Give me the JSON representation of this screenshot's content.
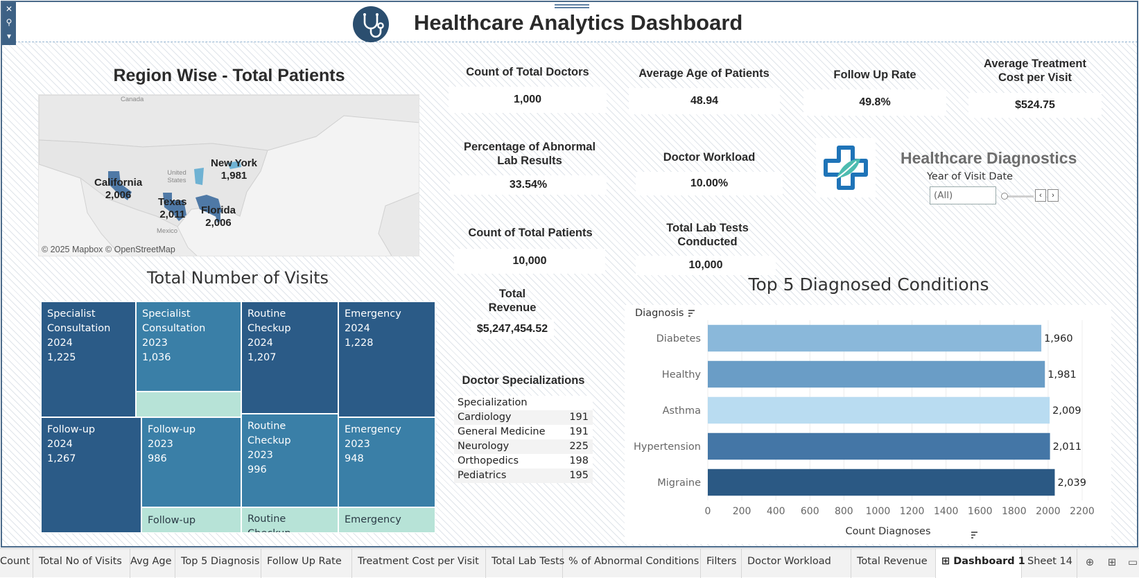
{
  "header": {
    "title": "Healthcare Analytics Dashboard"
  },
  "map": {
    "title": "Region Wise - Total Patients",
    "countries": {
      "canada": "Canada",
      "usa": "United States",
      "mexico": "Mexico"
    },
    "regions": [
      {
        "name": "California",
        "value": "2,006"
      },
      {
        "name": "New York",
        "value": "1,981"
      },
      {
        "name": "Texas",
        "value": "2,011"
      },
      {
        "name": "Florida",
        "value": "2,006"
      }
    ],
    "credit": "© 2025 Mapbox © OpenStreetMap",
    "fill_color": "#4f79a6",
    "ny_color": "#6fb2d3"
  },
  "kpis": {
    "doctors": {
      "label": "Count of Total Doctors",
      "value": "1,000"
    },
    "avg_age": {
      "label": "Average Age of Patients",
      "value": "48.94"
    },
    "follow_up": {
      "label": "Follow Up Rate",
      "value": "49.8%"
    },
    "avg_cost_line1": "Average Treatment",
    "avg_cost_line2": "Cost per Visit",
    "avg_cost_value": "$524.75",
    "abnormal_line1": "Percentage of Abnormal",
    "abnormal_line2": "Lab Results",
    "abnormal_value": "33.54%",
    "workload": {
      "label": "Doctor Workload",
      "value": "10.00%"
    },
    "patients": {
      "label": "Count of Total Patients",
      "value": "10,000"
    },
    "labtests_line1": "Total Lab Tests",
    "labtests_line2": "Conducted",
    "labtests_value": "10,000",
    "revenue_line1": "Total",
    "revenue_line2": "Revenue",
    "revenue_value": "$5,247,454.52"
  },
  "visits": {
    "title": "Total Number of Visits",
    "tiles": {
      "spec_2024": [
        "Specialist",
        "Consultation",
        "2024",
        "1,225"
      ],
      "spec_2023": [
        "Specialist",
        "Consultation",
        "2023",
        "1,036"
      ],
      "routine_2024": [
        "Routine Checkup",
        "2024",
        "1,207"
      ],
      "emergency_2024": [
        "Emergency",
        "2024",
        "1,228"
      ],
      "follow_2024": [
        "Follow-up",
        "2024",
        "1,267"
      ],
      "follow_2023": [
        "Follow-up",
        "2023",
        "986"
      ],
      "routine_2023": [
        "Routine Checkup",
        "2023",
        "996"
      ],
      "emergency_2023": [
        "Emergency",
        "2023",
        "948"
      ],
      "follow_other": "Follow-up",
      "routine_other": "Routine Checkup",
      "emergency_other": "Emergency"
    },
    "colors": {
      "dark": "#2b5b87",
      "mid": "#3a7fa7",
      "light": "#b7e3d7"
    }
  },
  "specializations": {
    "title": "Doctor Specializations",
    "header": "Specialization",
    "rows": [
      {
        "name": "Cardiology",
        "count": "191"
      },
      {
        "name": "General Medicine",
        "count": "191"
      },
      {
        "name": "Neurology",
        "count": "225"
      },
      {
        "name": "Orthopedics",
        "count": "198"
      },
      {
        "name": "Pediatrics",
        "count": "195"
      }
    ]
  },
  "diagnostics": {
    "title": "Healthcare Diagnostics",
    "filter_label": "Year of Visit Date",
    "filter_value": "(All)"
  },
  "chart_data": {
    "type": "bar",
    "orientation": "horizontal",
    "title": "Top 5 Diagnosed Conditions",
    "ylabel": "Diagnosis",
    "xlabel": "Count Diagnoses",
    "categories": [
      "Diabetes",
      "Healthy",
      "Asthma",
      "Hypertension",
      "Migraine"
    ],
    "values": [
      1960,
      1981,
      2009,
      2011,
      2039
    ],
    "value_labels": [
      "1,960",
      "1,981",
      "2,009",
      "2,011",
      "2,039"
    ],
    "colors": [
      "#8ab8da",
      "#6a9dc6",
      "#b9dcf1",
      "#4476a6",
      "#2b5984"
    ],
    "xlim": [
      0,
      2200
    ],
    "xticks": [
      0,
      200,
      400,
      600,
      800,
      1000,
      1200,
      1400,
      1600,
      1800,
      2000,
      2200
    ],
    "grid": true
  },
  "tabs": [
    "Count",
    "Total No of Visits",
    "Avg Age",
    "Top 5 Diagnosis",
    "Follow Up Rate",
    "Treatment Cost per Visit",
    "Total Lab Tests",
    "% of Abnormal Conditions",
    "Filters",
    "Doctor Workload",
    "Total Revenue",
    "Dashboard 1",
    "Sheet 14"
  ],
  "active_tab": "Dashboard 1"
}
